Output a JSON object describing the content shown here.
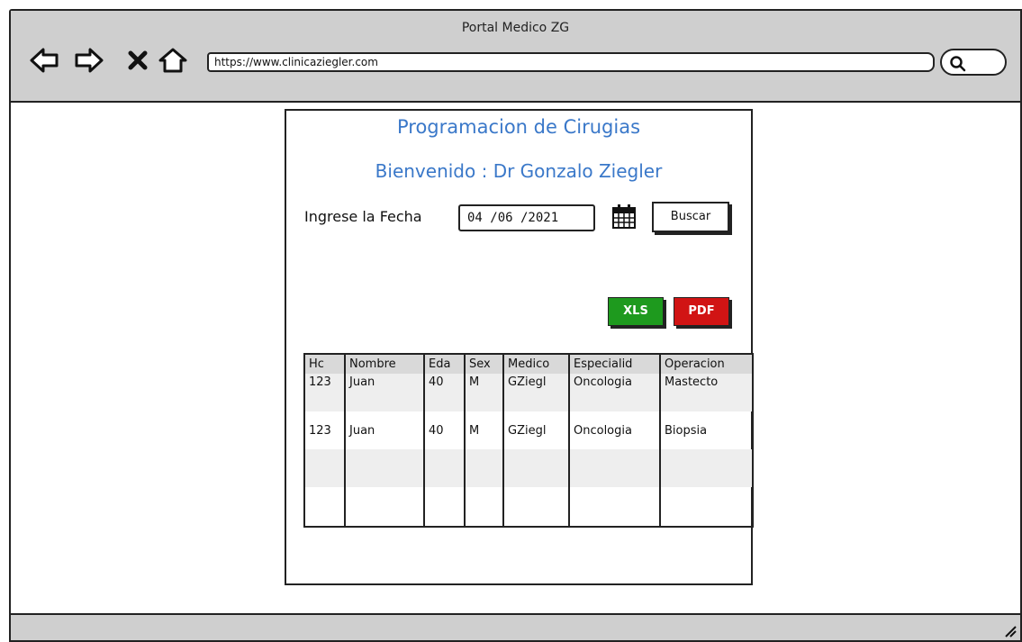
{
  "window": {
    "title": "Portal Medico ZG",
    "url": "https://www.clinicaziegler.com"
  },
  "icons": {
    "back": "back-arrow-icon",
    "forward": "forward-arrow-icon",
    "stop": "close-icon",
    "home": "home-icon",
    "search": "search-icon",
    "calendar": "calendar-icon",
    "resize": "resize-grip-icon"
  },
  "page": {
    "title": "Programacion de Cirugias",
    "welcome": "Bienvenido : Dr Gonzalo Ziegler",
    "date_label": "Ingrese la Fecha",
    "date_value": "04 /06 /2021",
    "search_button": "Buscar",
    "export_xls": "XLS",
    "export_pdf": "PDF"
  },
  "table": {
    "columns": [
      "Hc",
      "Nombre",
      "Eda",
      "Sex",
      "Medico",
      "Especialid",
      "Operacion"
    ],
    "rows": [
      [
        "123",
        "Juan",
        "40",
        "M",
        "GZiegl",
        "Oncologia",
        "Mastecto"
      ],
      [
        "123",
        "Juan",
        "40",
        "M",
        "GZiegl",
        "Oncologia",
        "Biopsia"
      ],
      [
        "",
        "",
        "",
        "",
        "",
        "",
        ""
      ],
      [
        "",
        "",
        "",
        "",
        "",
        "",
        ""
      ]
    ]
  },
  "colors": {
    "heading": "#3a78c9",
    "xls": "#1e9a1e",
    "pdf": "#d11414",
    "chrome": "#cfcfcf"
  }
}
